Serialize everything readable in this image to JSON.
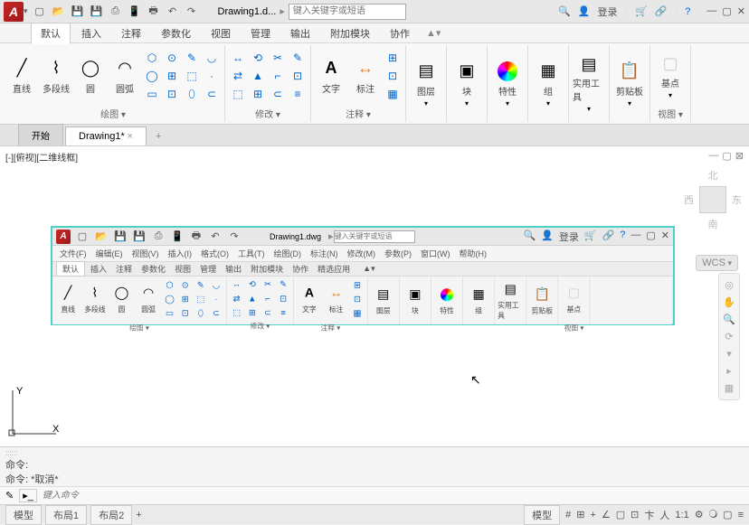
{
  "app": {
    "logo": "A",
    "title": "Drawing1.d...",
    "search_placeholder": "键入关键字或短语",
    "login": "登录"
  },
  "menus": [
    "默认",
    "插入",
    "注释",
    "参数化",
    "视图",
    "管理",
    "输出",
    "附加模块",
    "协作"
  ],
  "ribbon": {
    "draw": {
      "title": "绘图 ▾",
      "line": "直线",
      "pline": "多段线",
      "circle": "圆",
      "arc": "圆弧"
    },
    "modify": {
      "title": "修改 ▾"
    },
    "annot": {
      "title": "注释 ▾",
      "text": "文字",
      "dim": "标注"
    },
    "layer": {
      "label": "图层"
    },
    "block": {
      "label": "块"
    },
    "prop": {
      "label": "特性"
    },
    "group": {
      "label": "组"
    },
    "util": {
      "label": "实用工具"
    },
    "clip": {
      "label": "剪贴板"
    },
    "view": {
      "title": "视图 ▾",
      "base": "基点"
    }
  },
  "doctabs": {
    "start": "开始",
    "drawing": "Drawing1*"
  },
  "viewport": {
    "label": "[-][俯视][二维线框]",
    "wcs": "WCS",
    "axes": {
      "x": "X",
      "y": "Y"
    }
  },
  "navcube": {
    "n": "北",
    "s": "南",
    "e": "东",
    "w": "西"
  },
  "inset": {
    "title": "Drawing1.dwg",
    "search": "键入关键字或短语",
    "login": "登录",
    "menus": [
      "文件(F)",
      "编辑(E)",
      "视图(V)",
      "插入(I)",
      "格式(O)",
      "工具(T)",
      "绘图(D)",
      "标注(N)",
      "修改(M)",
      "参数(P)",
      "窗口(W)",
      "帮助(H)"
    ],
    "tabs": [
      "默认",
      "插入",
      "注释",
      "参数化",
      "视图",
      "管理",
      "输出",
      "附加模块",
      "协作",
      "精选应用"
    ]
  },
  "cmd": {
    "l1": "命令:",
    "l2": "命令: *取消*",
    "prompt": "键入命令"
  },
  "status": {
    "model": "模型",
    "layout1": "布局1",
    "layout2": "布局2",
    "modelbtn": "模型",
    "scale": "1:1"
  }
}
